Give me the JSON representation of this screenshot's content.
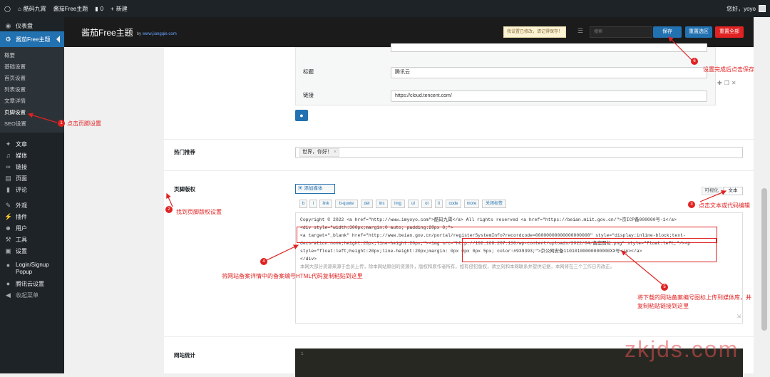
{
  "admin_bar": {
    "site_name": "酷码九霄",
    "theme_name": "酱茄Free主题",
    "comments_count": "0",
    "new_label": "新建",
    "greeting": "您好，yoyo"
  },
  "sidebar": {
    "dashboard": "仪表盘",
    "theme": "酱茄Free主题",
    "subitems": [
      "概要",
      "基础设置",
      "首页设置",
      "列表设置",
      "文章详情",
      "页脚设置",
      "SEO设置"
    ],
    "items": [
      "文章",
      "媒体",
      "链接",
      "页面",
      "评论",
      "外观",
      "插件",
      "用户",
      "工具",
      "设置",
      "Login/Signup Popup",
      "腾讯云设置",
      "收起菜单"
    ]
  },
  "topbar": {
    "title": "酱茄Free主题",
    "by_prefix": "by",
    "by_link": "www.jiangqie.com",
    "notice": "我设置已修改，请记得保存！",
    "search_placeholder": "搜索",
    "save": "保存",
    "reset_section": "重置选区",
    "reset_all": "重置全部"
  },
  "form": {
    "title_label": "标题",
    "title_value": "腾讯云",
    "link_label": "链接",
    "link_value": "https://cloud.tencent.com/",
    "hot_label": "热门推荐",
    "hot_tag": "世界，你好！",
    "copyright_label": "页脚版权",
    "add_media": "添加媒体",
    "tab_visual": "可视化",
    "tab_text": "文本",
    "toolbar": [
      "b",
      "i",
      "link",
      "b-quote",
      "del",
      "ins",
      "img",
      "ul",
      "ol",
      "li",
      "code",
      "more",
      "关闭标签"
    ],
    "stats_label": "网站统计",
    "stats_line": "1"
  },
  "editor": {
    "lines": [
      "Copyright © 2022 <a href=\"http://www.imyoyo.com\">酷码九霄</a> All rights reserved <a href=\"https://beian.miit.gov.cn/\">京ICP备000000号-1</a>",
      "<div style=\"width:300px;margin:0 auto; padding:20px 0;\">",
      "<a target=\"_blank\" href=\"http://www.beian.gov.cn/portal/registerSystemInfo?recordcode=00000000000000000000\" style=\"display:inline-block;text-",
      "decoration:none;height:20px;line-height:20px;\"><img src=\"http://192.168.207.130/wp-content/uploads/2022/04/备案图标.png\" style=\"float:left;\"/><p",
      "style=\"float:left;height:20px;line-height:20px;margin: 0px 0px 0px 5px; color:#939393;\">京公网安备11010100000000000XX号</p></a>",
      "</div>",
      "本网大部分资源来源于会员上传，除本网站原创的资源外，版权和原作者所有，如有侵犯版权，请立刻和本网联系并提供证据，本网将在三个工作日内改正。"
    ]
  },
  "annotations": {
    "a1": "点击页脚设置",
    "a2": "找到页脚版权设置",
    "a3": "点击文本或代码编辑",
    "a4": "将网站备案详情中的备案编号HTML代码复制粘贴到这里",
    "a5_line1": "将下载的网站备案编号图标上传到媒体库，并",
    "a5_line2": "复制粘贴链接到这里",
    "a6": "设置完成后点击保存",
    "n1": "1",
    "n2": "2",
    "n3": "3",
    "n4": "4",
    "n5": "5",
    "n6": "6"
  },
  "watermark": "zkjds.com",
  "colors": {
    "wp_blue": "#2271b1",
    "red_btn": "#e02222",
    "annotation": "#e02222",
    "sidebar_bg": "#1d2327"
  }
}
